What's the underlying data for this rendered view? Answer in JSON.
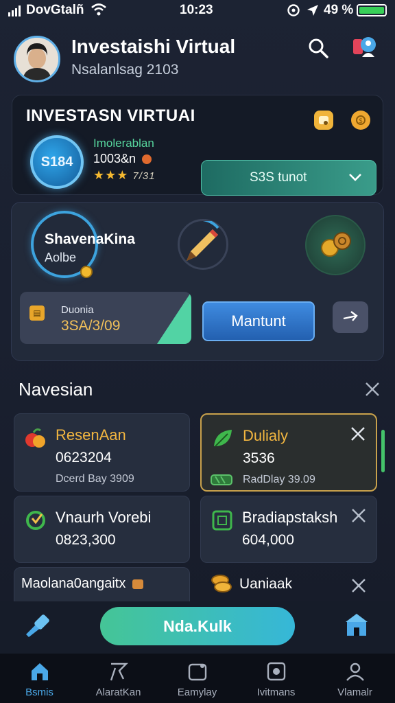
{
  "status_bar": {
    "carrier": "DovGtalñ",
    "time": "10:23",
    "battery_pct": "49 %"
  },
  "header": {
    "title": "Investaishi Virtual",
    "subtitle": "Nsalanlsag 2103"
  },
  "summary_card": {
    "heading": "INVESTASN VIRTUAI",
    "badge_value": "S184",
    "label_green": "Imolerablan",
    "amount": "1003&n",
    "stars": "★★★",
    "rating": "7/31",
    "select_label": "S3S tunot"
  },
  "profile_card": {
    "name": "ShavenaKina",
    "sub": "Aolbe",
    "duration_label": "Duonia",
    "duration_value": "3SA/3/09",
    "primary_button": "Mantunt"
  },
  "section": {
    "title": "Navesian",
    "tiles": [
      {
        "title": "ResenAan",
        "value": "0623204",
        "meta": "Dcerd Bay 3909",
        "title_color": "#f2b640",
        "icon": "apple-icon",
        "active": false
      },
      {
        "title": "Dulialy",
        "value": "3536",
        "meta": "RadDlay 39.09",
        "title_color": "#f2b640",
        "icon": "leaf-icon",
        "active": true
      },
      {
        "title": "Vnaurh Vorebi",
        "value": "0823,300",
        "meta": "",
        "title_color": "#ffffff",
        "icon": "refresh-icon",
        "active": false
      },
      {
        "title": "Bradiapstaksh",
        "value": "604,000",
        "meta": "",
        "title_color": "#ffffff",
        "icon": "square-icon",
        "active": false
      },
      {
        "title": "Maolana0angaitx",
        "value": "",
        "meta": "",
        "title_color": "#ffffff",
        "icon": "",
        "active": false
      },
      {
        "title": "Uaniaak",
        "value": "",
        "meta": "",
        "title_color": "#ffffff",
        "icon": "coins-icon",
        "active": false
      }
    ]
  },
  "action": {
    "button_label": "Nda.Kulk"
  },
  "tabs": [
    {
      "label": "Bsmis",
      "icon": "home-icon",
      "selected": true
    },
    {
      "label": "AlaratKan",
      "icon": "flag-icon",
      "selected": false
    },
    {
      "label": "Eamylay",
      "icon": "card-icon",
      "selected": false
    },
    {
      "label": "Ivitmans",
      "icon": "target-icon",
      "selected": false
    },
    {
      "label": "Vlamalr",
      "icon": "user-icon",
      "selected": false
    }
  ],
  "colors": {
    "accent_blue": "#3f8be0",
    "accent_teal": "#45c596",
    "gold": "#f2b640"
  }
}
